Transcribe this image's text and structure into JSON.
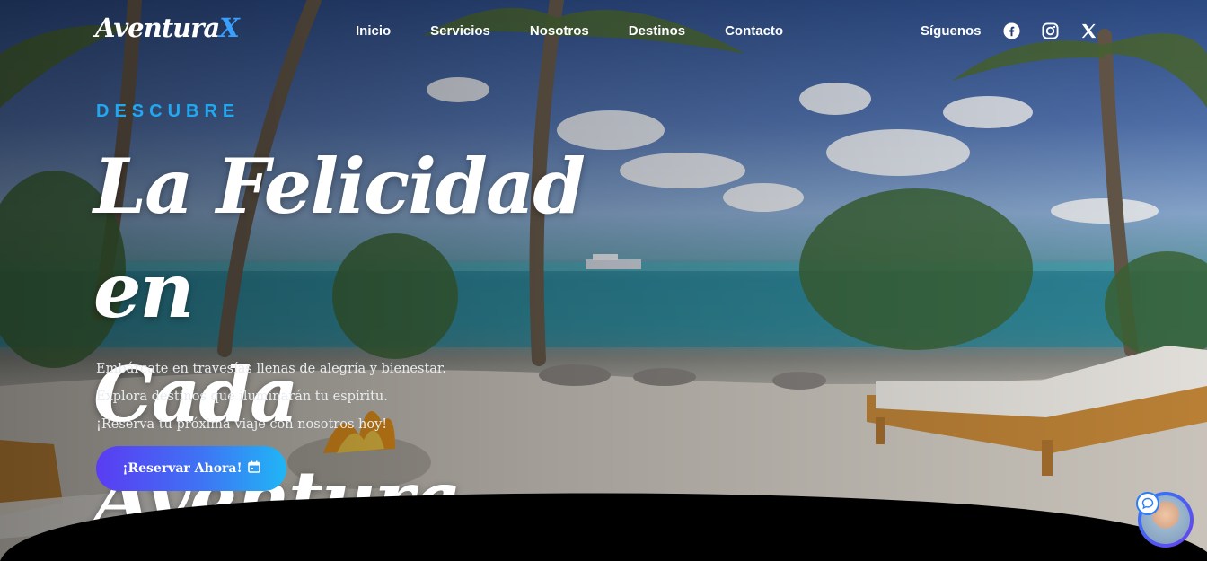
{
  "brand": {
    "name": "Aventura",
    "accent": "X",
    "accent_color": "#3aa0ff"
  },
  "nav": {
    "items": [
      "Inicio",
      "Servicios",
      "Nosotros",
      "Destinos",
      "Contacto"
    ]
  },
  "social": {
    "label": "Síguenos",
    "icons": [
      "facebook-icon",
      "instagram-icon",
      "x-twitter-icon"
    ]
  },
  "hero": {
    "eyebrow": "DESCUBRE",
    "title_line1": "La Felicidad en",
    "title_line2": "Cada Aventura",
    "lines": [
      "Embárcate en travesías llenas de alegría y bienestar.",
      "Explora destinos que iluminarán tu espíritu.",
      "¡Reserva tu próxima viaje con nosotros hoy!"
    ],
    "cta_label": "¡Reservar Ahora!",
    "cta_icon": "calendar-icon"
  },
  "chat": {
    "icon": "chat-bubble-icon"
  },
  "colors": {
    "eyebrow": "#22a8f0",
    "cta_start": "#5a3cf2",
    "cta_end": "#20b6f5"
  }
}
